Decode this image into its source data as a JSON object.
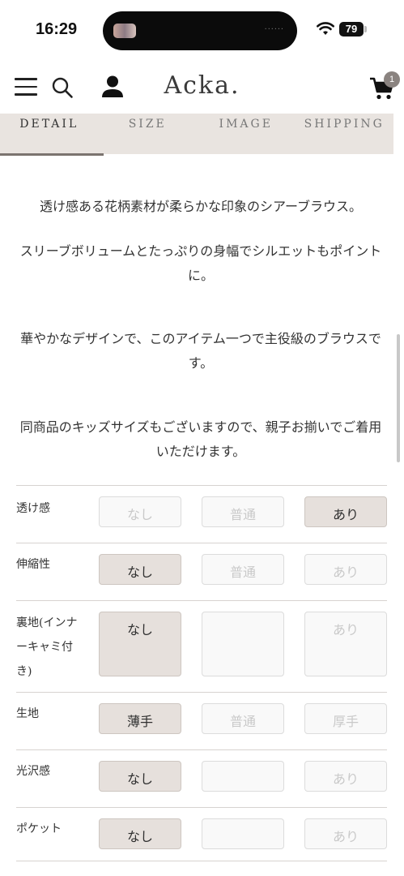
{
  "status_bar": {
    "time": "16:29",
    "island_dots": "......",
    "battery": "79"
  },
  "header": {
    "logo": "Acka.",
    "cart_count": "1"
  },
  "tabs": [
    {
      "label": "DETAIL",
      "active": true
    },
    {
      "label": "SIZE",
      "active": false
    },
    {
      "label": "IMAGE",
      "active": false
    },
    {
      "label": "SHIPPING",
      "active": false
    }
  ],
  "description": {
    "p1": "透け感ある花柄素材が柔らかな印象のシアーブラウス。",
    "p2": "スリーブボリュームとたっぷりの身幅でシルエットもポイントに。",
    "p3": "華やかなデザインで、このアイテム一つで主役級のブラウスです。",
    "p4": "同商品のキッズサイズもございますので、親子お揃いでご着用いただけます。"
  },
  "attributes": [
    {
      "label": "透け感",
      "options": [
        {
          "text": "なし",
          "selected": false
        },
        {
          "text": "普通",
          "selected": false
        },
        {
          "text": "あり",
          "selected": true
        }
      ]
    },
    {
      "label": "伸縮性",
      "options": [
        {
          "text": "なし",
          "selected": true
        },
        {
          "text": "普通",
          "selected": false
        },
        {
          "text": "あり",
          "selected": false
        }
      ]
    },
    {
      "label": "裏地(インナーキャミ付き)",
      "options": [
        {
          "text": "なし",
          "selected": true
        },
        {
          "text": "",
          "selected": false
        },
        {
          "text": "あり",
          "selected": false
        }
      ]
    },
    {
      "label": "生地",
      "options": [
        {
          "text": "薄手",
          "selected": true
        },
        {
          "text": "普通",
          "selected": false
        },
        {
          "text": "厚手",
          "selected": false
        }
      ]
    },
    {
      "label": "光沢感",
      "options": [
        {
          "text": "なし",
          "selected": true
        },
        {
          "text": "",
          "selected": false
        },
        {
          "text": "あり",
          "selected": false
        }
      ]
    },
    {
      "label": "ポケット",
      "options": [
        {
          "text": "なし",
          "selected": true
        },
        {
          "text": "",
          "selected": false
        },
        {
          "text": "あり",
          "selected": false
        }
      ]
    }
  ],
  "colors": {
    "selected_bg": "#e6e0dc",
    "tab_bg": "#e9e4e0",
    "tab_indicator": "#7b746f"
  }
}
